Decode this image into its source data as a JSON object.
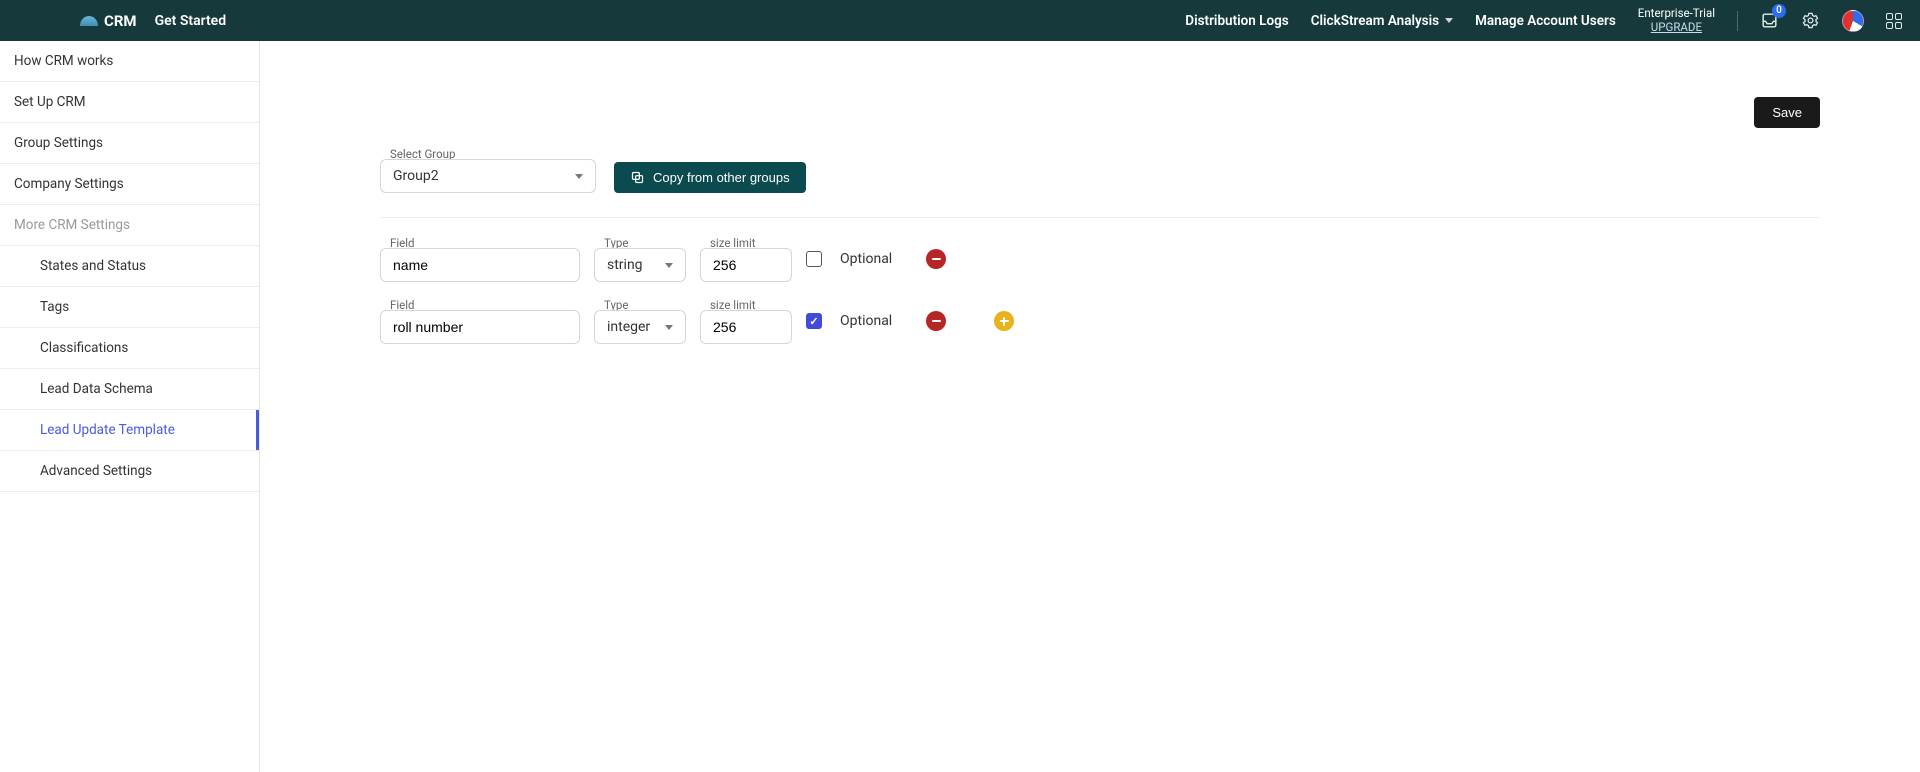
{
  "header": {
    "product": "CRM",
    "getStarted": "Get Started",
    "nav": {
      "distributionLogs": "Distribution Logs",
      "clickstream": "ClickStream Analysis",
      "manageUsers": "Manage Account Users"
    },
    "trial": {
      "label": "Enterprise-Trial",
      "upgrade": "UPGRADE"
    },
    "inboxBadge": "0"
  },
  "sidebar": {
    "items": {
      "howWorks": "How CRM works",
      "setup": "Set Up CRM",
      "groupSettings": "Group Settings",
      "companySettings": "Company Settings"
    },
    "moreHeading": "More CRM Settings",
    "sub": {
      "states": "States and Status",
      "tags": "Tags",
      "classifications": "Classifications",
      "leadSchema": "Lead Data Schema",
      "leadUpdate": "Lead Update Template",
      "advanced": "Advanced Settings"
    }
  },
  "main": {
    "saveLabel": "Save",
    "selectGroupLabel": "Select Group",
    "selectGroupValue": "Group2",
    "copyLabel": "Copy from other groups",
    "labels": {
      "field": "Field",
      "type": "Type",
      "size": "size limit",
      "optional": "Optional"
    },
    "rows": [
      {
        "field": "name",
        "type": "string",
        "size": "256",
        "optional": false
      },
      {
        "field": "roll number",
        "type": "integer",
        "size": "256",
        "optional": true
      }
    ]
  }
}
